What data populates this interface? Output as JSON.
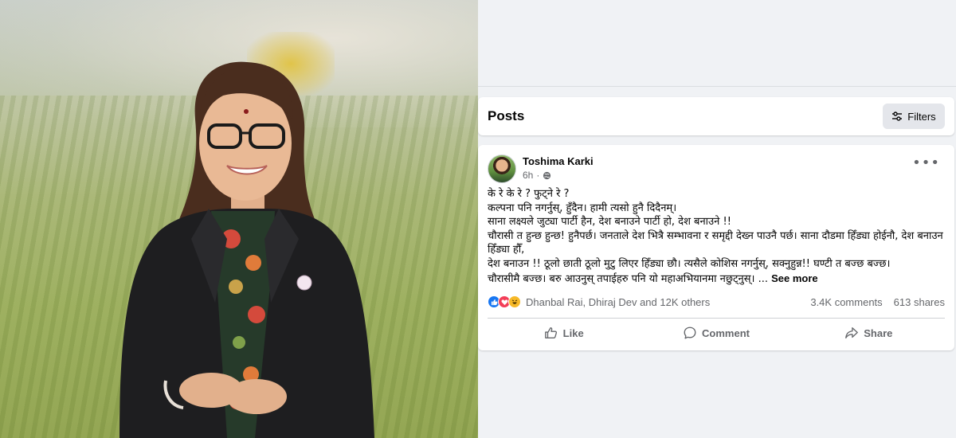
{
  "posts_header": {
    "title": "Posts",
    "filters_label": "Filters"
  },
  "post": {
    "author": "Toshima Karki",
    "time": "6h",
    "audience_icon": "globe-icon",
    "lines": [
      "के रे के रे ? फुट्ने रे ?",
      "कल्पना पनि नगर्नुस्, हुँदैन। हामी त्यसो हुनै दिदैनम्।",
      "साना लक्ष्यले जुट्या पार्टी हैन, देश बनाउने पार्टी हो, देश बनाउने !!",
      "चौरासी त हुन्छ हुन्छ! हुनैपर्छ। जनताले देश भित्रै सम्भावना र समृद्दी देख्न पाउनै पर्छ। साना दौडमा हिँड्या होईनौ, देश बनाउन हिँड्या हौँ,",
      "देश बनाउन !! ठूलो छाती ठूलो मुटु लिएर हिँड्या छौ। त्यसैले कोशिस नगर्नुस्, सक्नुहुन्न!! घण्टी त बज्छ बज्छ।"
    ],
    "last_line": "चौरासीमै बज्छ। बरु आउनुस् तपाईहरु पनि यो महाअभियानमा नछुट्नुस्। ...",
    "see_more": "See more",
    "reactors": "Dhanbal Rai, Dhiraj Dev and 12K others",
    "comments_count": "3.4K comments",
    "shares_count": "613 shares",
    "actions": {
      "like": "Like",
      "comment": "Comment",
      "share": "Share"
    }
  },
  "colors": {
    "link_blue": "#1877f2",
    "love_red": "#f33e58",
    "haha_yellow": "#f7b928",
    "muted_text": "#65676b"
  }
}
